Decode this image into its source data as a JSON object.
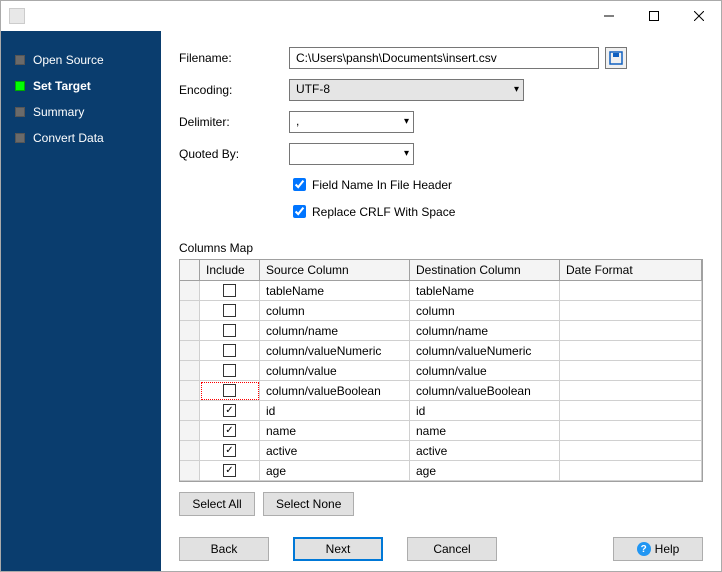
{
  "titlebar": {
    "title": ""
  },
  "sidebar": {
    "items": [
      {
        "label": "Open Source",
        "state": "done"
      },
      {
        "label": "Set Target",
        "state": "current"
      },
      {
        "label": "Summary",
        "state": "pending"
      },
      {
        "label": "Convert Data",
        "state": "pending"
      }
    ]
  },
  "form": {
    "filename_label": "Filename:",
    "filename_value": "C:\\Users\\pansh\\Documents\\insert.csv",
    "encoding_label": "Encoding:",
    "encoding_value": "UTF-8",
    "delimiter_label": "Delimiter:",
    "delimiter_value": ",",
    "quoted_label": "Quoted By:",
    "quoted_value": "",
    "field_header_label": "Field Name In File Header",
    "field_header_checked": true,
    "replace_crlf_label": "Replace CRLF With Space",
    "replace_crlf_checked": true
  },
  "columns_map": {
    "label": "Columns Map",
    "headers": {
      "include": "Include",
      "source": "Source Column",
      "destination": "Destination Column",
      "format": "Date Format"
    },
    "rows": [
      {
        "include": false,
        "source": "tableName",
        "destination": "tableName",
        "format": ""
      },
      {
        "include": false,
        "source": "column",
        "destination": "column",
        "format": ""
      },
      {
        "include": false,
        "source": "column/name",
        "destination": "column/name",
        "format": ""
      },
      {
        "include": false,
        "source": "column/valueNumeric",
        "destination": "column/valueNumeric",
        "format": ""
      },
      {
        "include": false,
        "source": "column/value",
        "destination": "column/value",
        "format": ""
      },
      {
        "include": false,
        "source": "column/valueBoolean",
        "destination": "column/valueBoolean",
        "format": ""
      },
      {
        "include": true,
        "source": "id",
        "destination": "id",
        "format": ""
      },
      {
        "include": true,
        "source": "name",
        "destination": "name",
        "format": ""
      },
      {
        "include": true,
        "source": "active",
        "destination": "active",
        "format": ""
      },
      {
        "include": true,
        "source": "age",
        "destination": "age",
        "format": ""
      }
    ]
  },
  "buttons": {
    "select_all": "Select All",
    "select_none": "Select None",
    "back": "Back",
    "next": "Next",
    "cancel": "Cancel",
    "help": "Help"
  }
}
